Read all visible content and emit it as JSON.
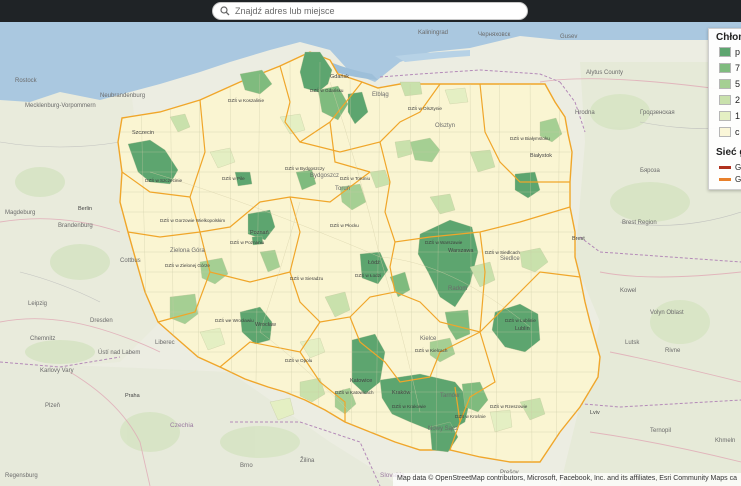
{
  "search": {
    "placeholder": "Znajdź adres lub miejsce"
  },
  "legend": {
    "title": "Chłon",
    "items": [
      {
        "label": "p",
        "color": "#5da56f"
      },
      {
        "label": "7",
        "color": "#7fbb7e"
      },
      {
        "label": "5",
        "color": "#a5cf93"
      },
      {
        "label": "2",
        "color": "#c9e1ac"
      },
      {
        "label": "1",
        "color": "#e4efc3"
      },
      {
        "label": "c",
        "color": "#faf6d8"
      }
    ],
    "network_title": "Sieć g",
    "network_items": [
      {
        "label": "G",
        "color": "#b0311e"
      },
      {
        "label": "G",
        "color": "#e8802a"
      }
    ]
  },
  "attribution": "Map data © OpenStreetMap contributors, Microsoft, Facebook, Inc. and its affiliates, Esri Community Maps ca",
  "colors": {
    "boundary": "#f0a62a",
    "land": "#efefe6",
    "water": "#aac8e0"
  },
  "map_labels": {
    "places": [
      "Kaliningrad",
      "Черняховск",
      "Gusev",
      "Alytus County",
      "Hrodna",
      "Гродзенская",
      "Rostock",
      "Mecklenburg-Vorpommern",
      "Neubrandenburg",
      "Szczecin",
      "Berlin",
      "Magdeburg",
      "Brandenburg",
      "Cottbus",
      "Zielona Góra",
      "Leipzig",
      "Dresden",
      "Chemnitz",
      "Liberec",
      "Ústí nad Labem",
      "Karlovy Vary",
      "Plzeň",
      "Praha",
      "Czechia",
      "Regensburg",
      "Brno",
      "Gdańsk",
      "Elbląg",
      "Olsztyn",
      "Toruń",
      "Bydgoszcz",
      "Poznań",
      "Warszawa",
      "Łódź",
      "Lublin",
      "Kraków",
      "Katowice",
      "Tarnów",
      "Nowy Sącz",
      "Wrocław",
      "Kielce",
      "Radom",
      "Siedlce",
      "Białystok",
      "Brest",
      "Brest Region",
      "Бяроза",
      "Kowel",
      "Volyn Oblast",
      "Lutsk",
      "Rivne",
      "Lviv",
      "Ternopil",
      "Khmeln",
      "Slovakia",
      "Žilina",
      "Prešov"
    ],
    "districts": [
      "DZŚ w Koszalinie",
      "DZŚ w Gdańsku",
      "DZŚ w Olsztynie",
      "DZŚ w Białymstoku",
      "DZŚ w Szczecinie",
      "DZŚ w Pile",
      "DZŚ w Bydgoszczy",
      "DZŚ w Toruniu",
      "DZŚ w Gorzowie Wielkopolskim",
      "DZŚ w Poznaniu",
      "DZŚ w Płocku",
      "DZŚ w Warszawie",
      "DZŚ w Zielonej Górze",
      "DZŚ w Sieradzu",
      "DZŚ w Łodzi",
      "DZŚ w Siedlcach",
      "DZŚ we Wrocławiu",
      "DZŚ w Lublinie",
      "DZŚ w Kielcach",
      "DZŚ w Opolu",
      "DZŚ w Katowicach",
      "DZŚ w Krakowie",
      "DZŚ w Krośnie",
      "DZŚ w Rzeszowie"
    ]
  }
}
